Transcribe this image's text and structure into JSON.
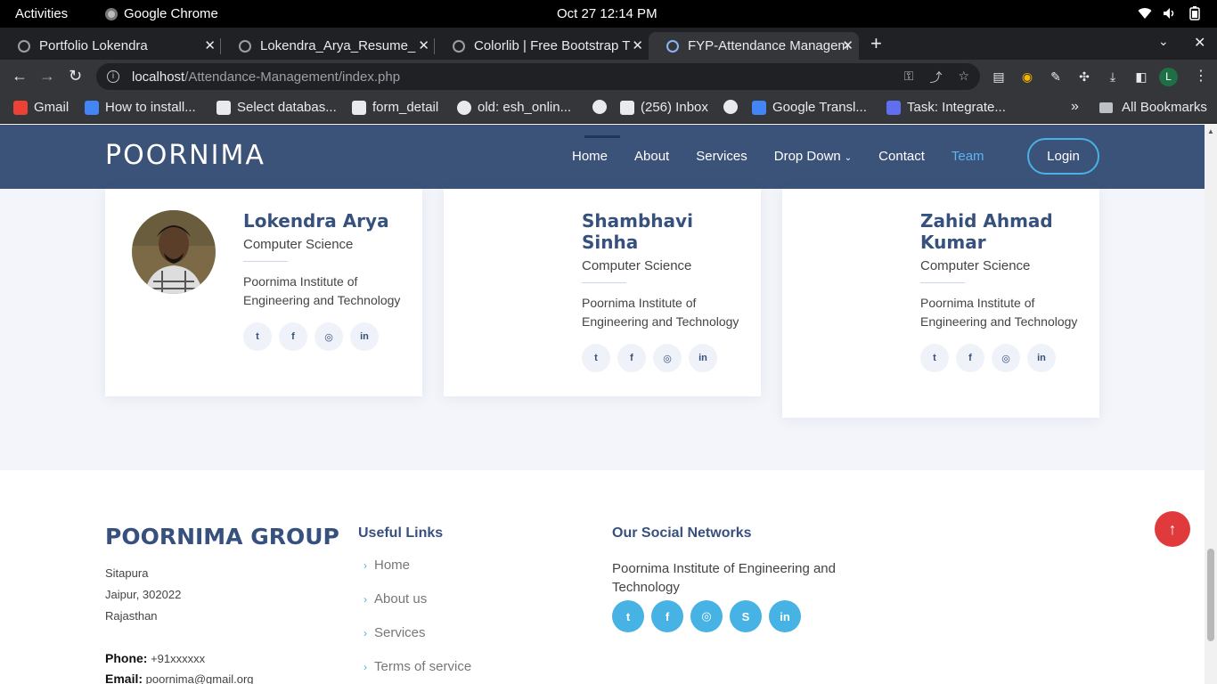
{
  "system": {
    "activities": "Activities",
    "app_name": "Google Chrome",
    "clock": "Oct 27  12:14 PM",
    "icons": [
      "wifi-icon",
      "volume-icon",
      "battery-icon"
    ]
  },
  "tabs": [
    {
      "title": "Portfolio Lokendra",
      "active": false
    },
    {
      "title": "Lokendra_Arya_Resume_",
      "active": false
    },
    {
      "title": "Colorlib | Free Bootstrap T",
      "active": false
    },
    {
      "title": "FYP-Attendance Managem",
      "active": true
    }
  ],
  "omnibox": {
    "host": "localhost",
    "path": "/Attendance-Management/index.php"
  },
  "profile_initial": "L",
  "bookmarks": [
    {
      "label": "Gmail",
      "icon": "gmail-icon",
      "color": "#ea4335"
    },
    {
      "label": "How to install...",
      "icon": "d-icon",
      "color": "#4285f4"
    },
    {
      "label": "Select databas...",
      "icon": "db-icon",
      "color": "#e8eaed"
    },
    {
      "label": "form_detail",
      "icon": "db-icon",
      "color": "#e8eaed"
    },
    {
      "label": "old: esh_onlin...",
      "icon": "globe-icon",
      "color": "#e8eaed"
    },
    {
      "label": "",
      "icon": "globe-icon",
      "color": "#e8eaed"
    },
    {
      "label": "(256) Inbox",
      "icon": "mail-icon",
      "color": "#e8eaed"
    },
    {
      "label": "",
      "icon": "globe-icon",
      "color": "#e8eaed"
    },
    {
      "label": "Google Transl...",
      "icon": "translate-icon",
      "color": "#4285f4"
    },
    {
      "label": "Task: Integrate...",
      "icon": "link-icon",
      "color": "#5f6ff0"
    }
  ],
  "bookmarks_more": "»",
  "all_bookmarks": "All Bookmarks",
  "site": {
    "logo": "POORNIMA",
    "nav": [
      "Home",
      "About",
      "Services",
      "Drop Down",
      "Contact",
      "Team"
    ],
    "login": "Login"
  },
  "team": [
    {
      "name": "Lokendra Arya",
      "dept": "Computer Science",
      "institute": "Poornima Institute of Engineering and Technology",
      "has_photo": true
    },
    {
      "name": "Shambhavi Sinha",
      "dept": "Computer Science",
      "institute": "Poornima Institute of Engineering and Technology",
      "has_photo": false
    },
    {
      "name": "Zahid Ahmad Kumar",
      "dept": "Computer Science",
      "institute": "Poornima Institute of Engineering and Technology",
      "has_photo": false
    }
  ],
  "card_socials": [
    "twitter-icon",
    "facebook-icon",
    "instagram-icon",
    "linkedin-icon"
  ],
  "footer": {
    "group": "POORNIMA GROUP",
    "address": [
      "Sitapura",
      "Jaipur, 302022",
      "Rajasthan"
    ],
    "phone_label": "Phone:",
    "phone": "+91xxxxxx",
    "email_label": "Email:",
    "email": "poornima@gmail.org",
    "links_title": "Useful Links",
    "links": [
      "Home",
      "About us",
      "Services",
      "Terms of service"
    ],
    "social_title": "Our Social Networks",
    "social_text": "Poornima Institute of Engineering and Technology",
    "social_icons": [
      "twitter-icon",
      "facebook-icon",
      "instagram-icon",
      "skype-icon",
      "linkedin-icon"
    ]
  },
  "colors": {
    "header_bg": "#3b5279",
    "brand": "#37517e",
    "accent": "#47b2e4",
    "back_to_top": "#e03a3c"
  }
}
